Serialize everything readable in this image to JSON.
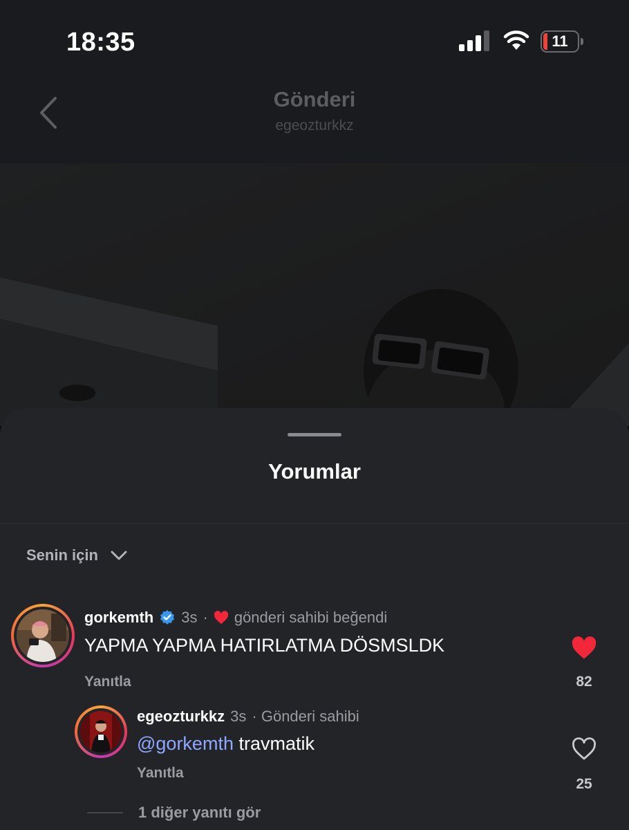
{
  "status_bar": {
    "time": "18:35",
    "battery_level": "11",
    "icons": [
      "signal-icon",
      "wifi-icon",
      "battery-icon"
    ]
  },
  "header": {
    "title": "Gönderi",
    "subtitle": "egeozturkkz"
  },
  "sheet": {
    "title": "Yorumlar",
    "sort_label": "Senin için"
  },
  "comments": [
    {
      "username": "gorkemth",
      "verified": true,
      "time": "3s",
      "separator": "·",
      "liked_by_owner_text": "gönderi sahibi beğendi",
      "text": "YAPMA YAPMA HATIRLATMA DÖSMSLDK",
      "reply_label": "Yanıtla",
      "like_count": "82",
      "liked": true
    }
  ],
  "replies": [
    {
      "username": "egeozturkkz",
      "time": "3s",
      "owner_label": "· Gönderi sahibi",
      "mention": "@gorkemth",
      "text": " travmatik",
      "reply_label": "Yanıtla",
      "like_count": "25",
      "liked": false
    }
  ],
  "more_replies_label": "1 diğer yanıtı gör",
  "colors": {
    "like_red": "#f0283a",
    "mention_blue": "#8fa8ff",
    "verified_blue": "#3897f0",
    "sheet_bg": "#232428"
  }
}
